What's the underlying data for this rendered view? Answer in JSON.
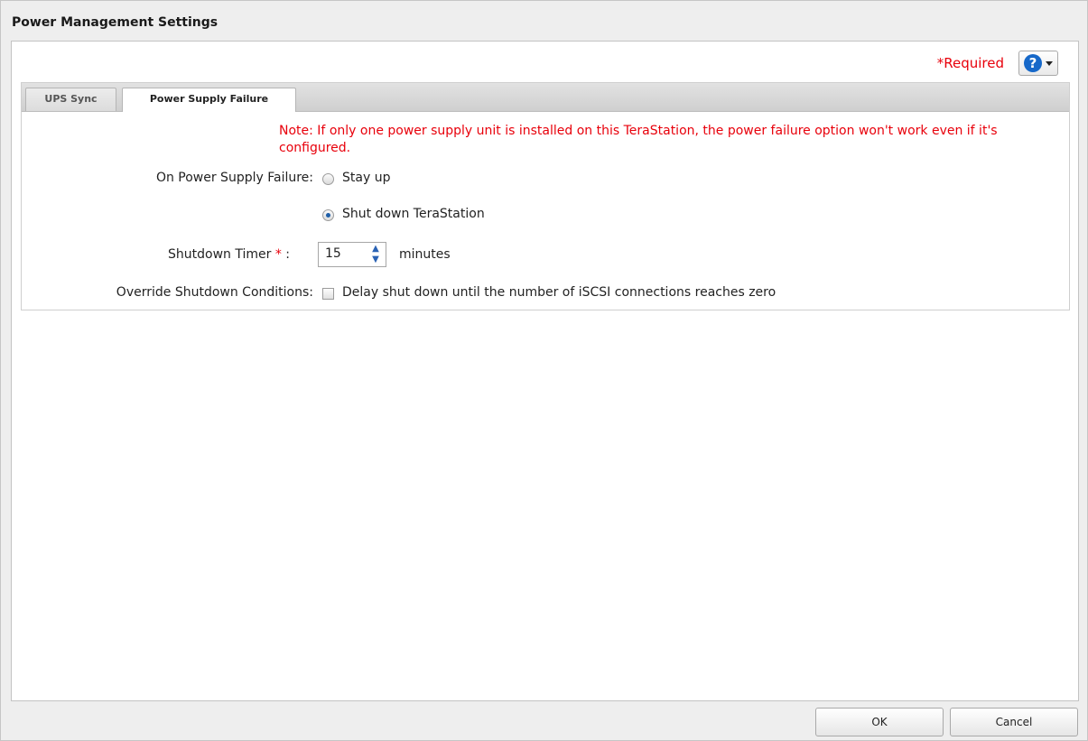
{
  "window": {
    "title": "Power Management Settings"
  },
  "header": {
    "required_label": "*Required",
    "help_icon": "question-circle-icon"
  },
  "tabs": [
    {
      "label": "UPS Sync",
      "active": false
    },
    {
      "label": "Power Supply Failure",
      "active": true
    }
  ],
  "note": "Note: If only one power supply unit is installed on this TeraStation, the power failure option won't work even if it's configured.",
  "form": {
    "power_failure": {
      "label": "On Power Supply Failure:",
      "options": [
        {
          "label": "Stay up",
          "selected": false
        },
        {
          "label": "Shut down TeraStation",
          "selected": true
        }
      ]
    },
    "shutdown_timer": {
      "label": "Shutdown Timer",
      "required_mark": "*",
      "colon": ":",
      "value": "15",
      "unit": "minutes"
    },
    "override": {
      "label": "Override Shutdown Conditions:",
      "checkbox_label": "Delay shut down until the number of iSCSI connections reaches zero",
      "checked": false
    }
  },
  "footer": {
    "ok_label": "OK",
    "cancel_label": "Cancel"
  },
  "colors": {
    "required": "#e8000b",
    "help_accent": "#1668c9"
  }
}
